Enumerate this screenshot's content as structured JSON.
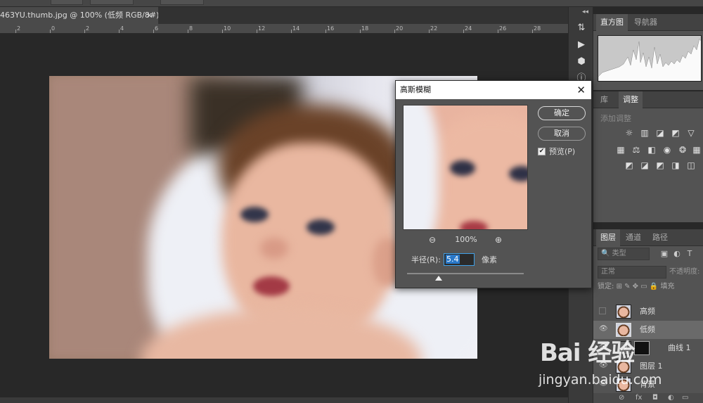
{
  "document": {
    "tab_title": "463YU.thumb.jpg @ 100% (低频 RGB/8#) *",
    "tab_close": "×",
    "ruler_ticks": [
      "2",
      "0",
      "2",
      "4",
      "6",
      "8",
      "10",
      "12",
      "14",
      "16",
      "18",
      "20",
      "22",
      "24",
      "26",
      "28"
    ]
  },
  "mini_tools": {
    "collapse": "◂◂",
    "items": [
      "⇅",
      "▶",
      "⬢",
      "ⓘ"
    ]
  },
  "histogram_panel": {
    "tabs": [
      "直方图",
      "导航器"
    ]
  },
  "adjustments_panel": {
    "tabs": [
      "库",
      "调整"
    ],
    "add_label": "添加调整",
    "icons_row1": [
      "☼",
      "▥",
      "◪",
      "◩",
      "▽"
    ],
    "icons_row2": [
      "▦",
      "⚖",
      "◧",
      "◉",
      "❂",
      "▦"
    ],
    "icons_row3": [
      "◩",
      "◪",
      "◩",
      "◨",
      "◫"
    ]
  },
  "layers_panel": {
    "tabs": [
      "图层",
      "通道",
      "路径"
    ],
    "kind_label": "🔍 类型",
    "blend_mode": "正常",
    "opacity_label": "不透明度:",
    "lock_label": "锁定:",
    "fill_label": "填充",
    "layers": [
      {
        "name": "高频",
        "visible": false,
        "selected": false
      },
      {
        "name": "低频",
        "visible": true,
        "selected": true
      },
      {
        "name": "曲线 1",
        "visible": true,
        "selected": false
      },
      {
        "name": "图层 1",
        "visible": true,
        "selected": false
      },
      {
        "name": "背景",
        "visible": true,
        "selected": false
      }
    ],
    "bottom_icons": [
      "⊘",
      "fx",
      "◘",
      "◐",
      "▭",
      "▣",
      "🗑"
    ]
  },
  "dialog": {
    "title": "高斯模糊",
    "close": "✕",
    "ok_label": "确定",
    "cancel_label": "取消",
    "preview_checked": "✔",
    "preview_label": "预览(P)",
    "zoom_out": "⊖",
    "zoom_level": "100%",
    "zoom_in": "⊕",
    "radius_label": "半径(R):",
    "radius_value": "5.4",
    "radius_unit": "像素",
    "slider_fraction": 0.27
  },
  "watermark": {
    "logo": "Bai 经验",
    "url": "jingyan.baidu.com"
  }
}
